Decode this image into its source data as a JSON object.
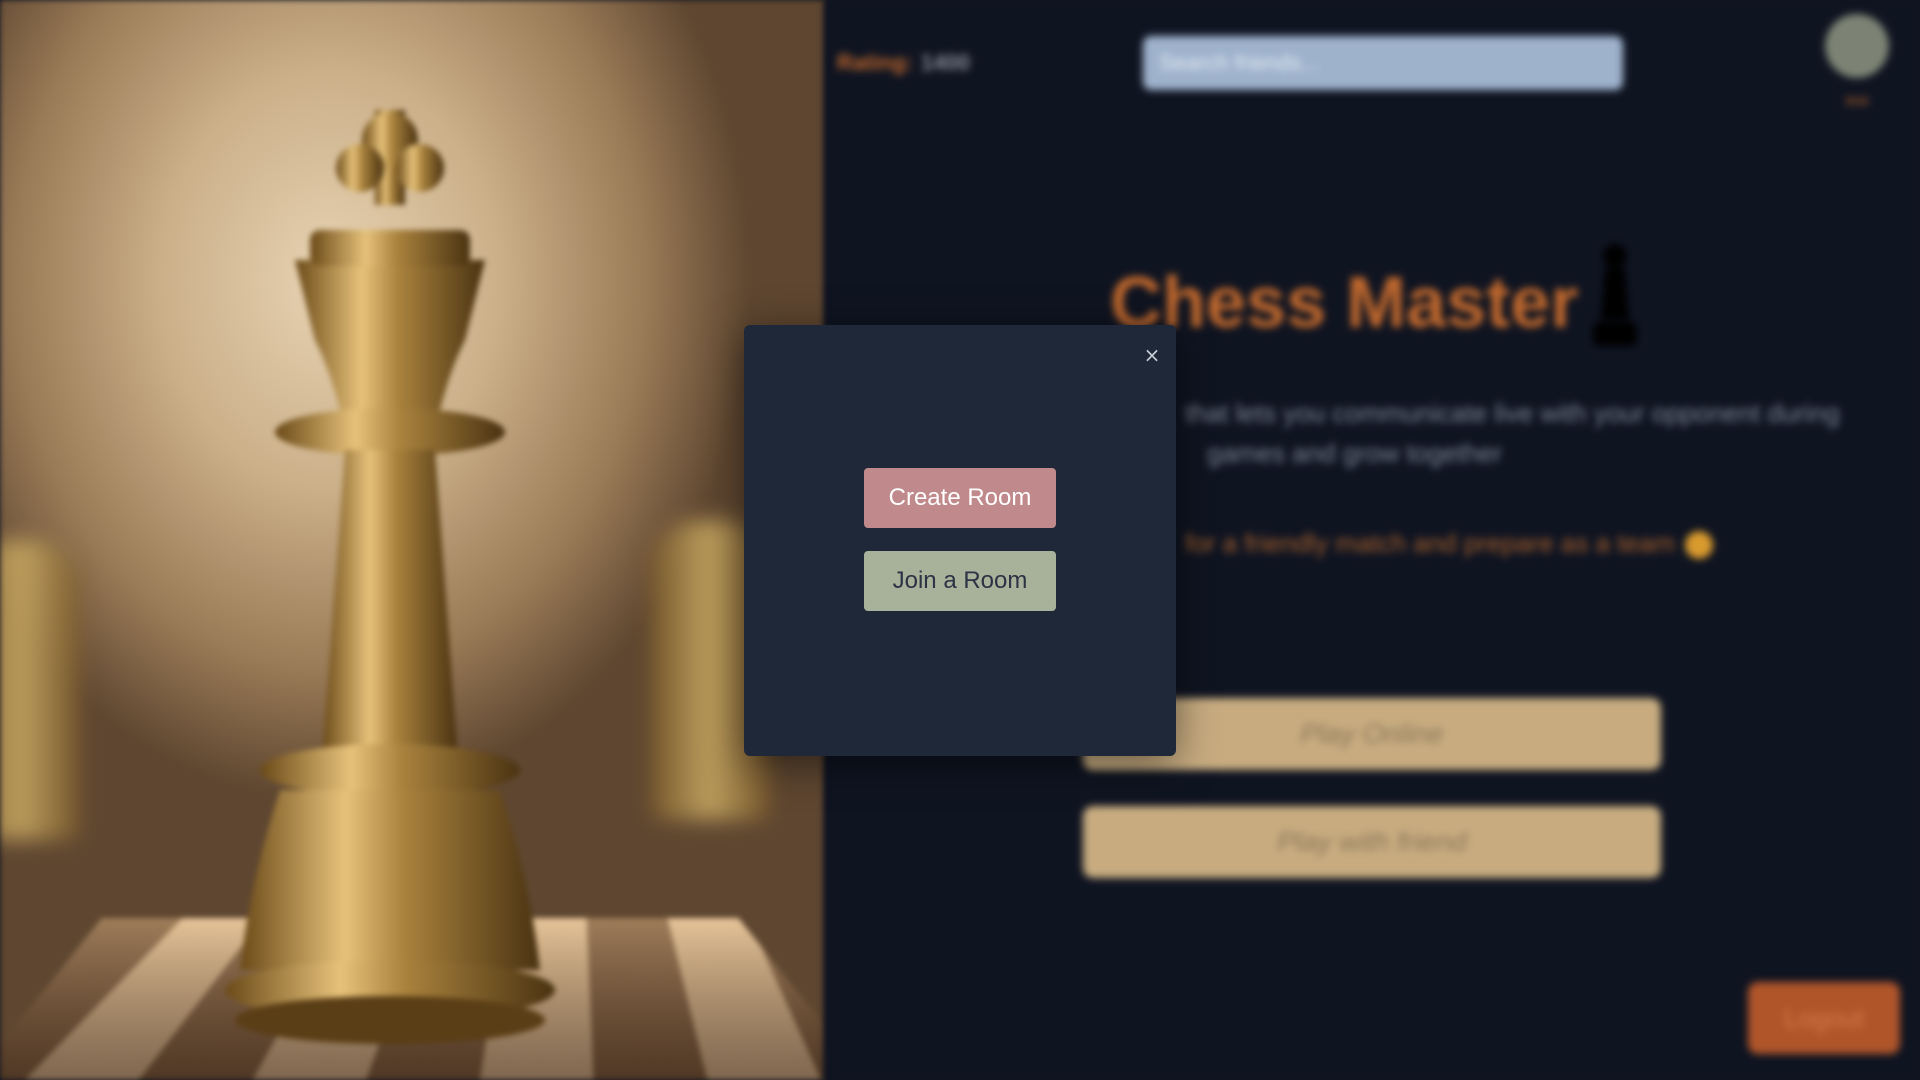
{
  "header": {
    "rating_label": "Rating:",
    "rating_value": "1400",
    "search_placeholder": "Search friends...",
    "avatar_name": "test"
  },
  "hero": {
    "title": "Chess Master",
    "tagline_line1": "that lets you communicate live with your opponent during",
    "tagline_line2": "games and grow together",
    "tagline_line3": "for a friendly match and prepare as a team"
  },
  "actions": {
    "play_online": "Play Online",
    "play_with_friend": "Play with friend",
    "logout": "Logout"
  },
  "modal": {
    "close": "×",
    "create_room": "Create Room",
    "join_room": "Join a Room"
  },
  "colors": {
    "background": "#0f1421",
    "accent": "#c0682d",
    "modal_bg": "#1e2839",
    "create_button": "#c08a8c",
    "join_button": "#a8b29a",
    "play_button": "#c8ac80"
  },
  "icons": {
    "pawn": "chess-pawn-icon",
    "close": "close-icon",
    "avatar": "avatar"
  }
}
